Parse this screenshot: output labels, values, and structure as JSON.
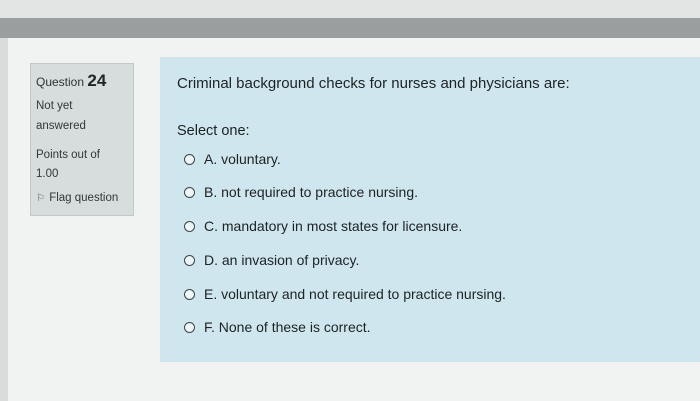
{
  "question_info": {
    "question_label": "Question",
    "question_number": "24",
    "state_line1": "Not yet",
    "state_line2": "answered",
    "points_line1": "Points out of",
    "points_line2": "1.00",
    "flag_label": "Flag question"
  },
  "question": {
    "text": "Criminal background checks for nurses and physicians are:",
    "prompt": "Select one:",
    "options": [
      {
        "label": "A. voluntary."
      },
      {
        "label": "B. not required to practice nursing."
      },
      {
        "label": "C. mandatory in most states for licensure."
      },
      {
        "label": "D. an invasion of privacy."
      },
      {
        "label": "E. voluntary and not required to practice nursing."
      },
      {
        "label": "F. None of these is correct."
      }
    ]
  },
  "colors": {
    "content_bg": "#cfe6ee",
    "info_bg": "#d7dcdd"
  }
}
